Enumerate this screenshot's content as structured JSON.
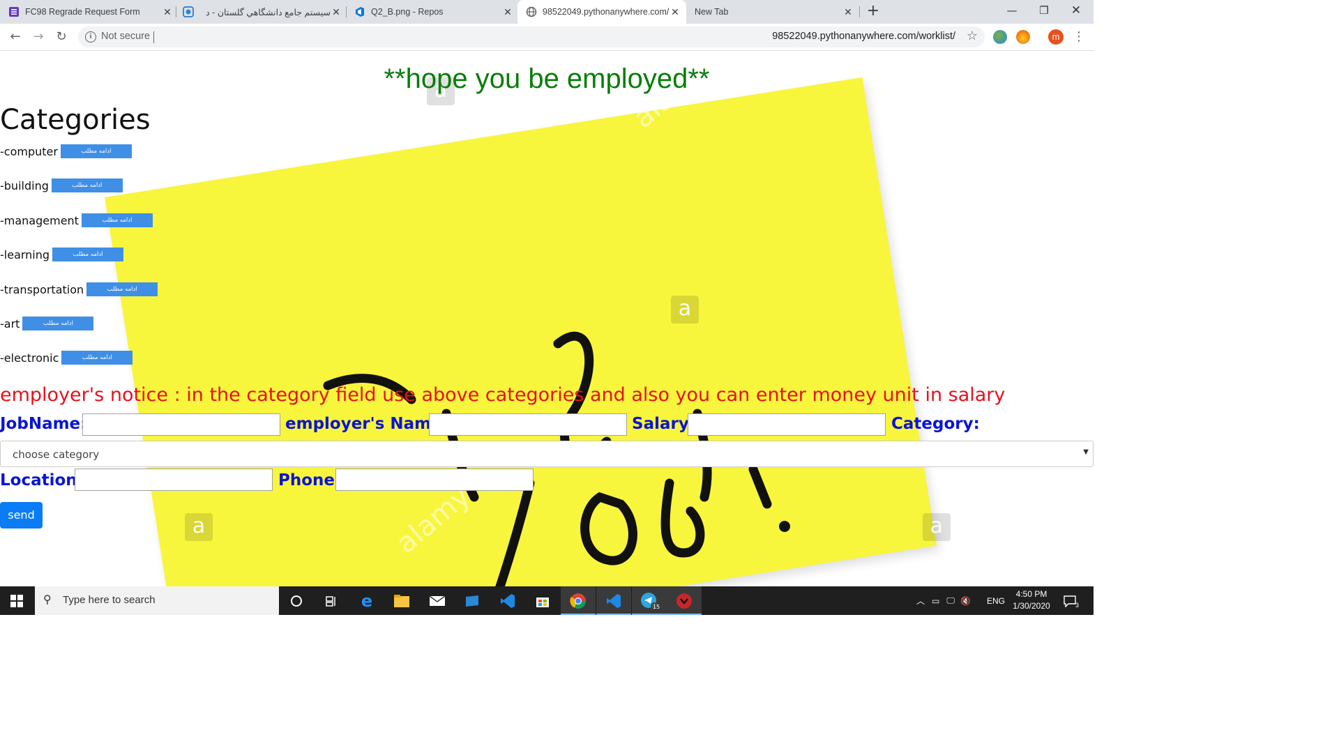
{
  "browser": {
    "tabs": [
      {
        "title": "FC98 Regrade Request Form",
        "icon": "forms-icon"
      },
      {
        "title": "سیستم جامع دانشگاهي گلستان - د",
        "icon": "university-icon"
      },
      {
        "title": "Q2_B.png - Repos",
        "icon": "azure-devops-icon"
      },
      {
        "title": "98522049.pythonanywhere.com/",
        "icon": "globe-icon"
      },
      {
        "title": "New Tab",
        "icon": ""
      }
    ],
    "security_label": "Not secure",
    "url": "98522049.pythonanywhere.com/worklist/",
    "profile_initial": "m"
  },
  "page": {
    "headline": "**hope you be employed**",
    "categories_title": "Categories",
    "more_button_label": "ادامه مطلب",
    "categories": [
      "-computer",
      "-building",
      "-management",
      "-learning",
      "-transportation",
      "-art",
      "-electronic"
    ],
    "notice": "employer's notice : in the category field use above categories and also you can enter money unit in salary",
    "form": {
      "jobname_label": "JobName:",
      "employer_label": "employer's Name:",
      "salary_label": "Salary:",
      "category_label": "Category:",
      "category_selected": "choose category",
      "location_label": "Location:",
      "phone_label": "Phone:",
      "send_label": "send"
    },
    "background_text": "Find Job!",
    "watermark_text": "alamy"
  },
  "taskbar": {
    "search_placeholder": "Type here to search",
    "language": "ENG",
    "time": "4:50 PM",
    "date": "1/30/2020",
    "notification_count": "3",
    "telegram_badge": "15"
  }
}
